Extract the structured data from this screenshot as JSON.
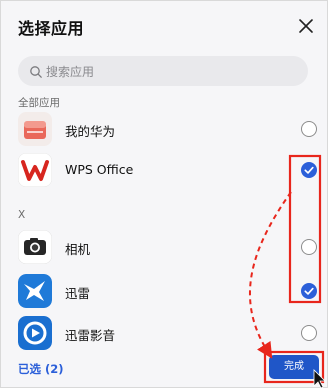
{
  "dialog": {
    "title": "选择应用"
  },
  "search": {
    "placeholder": "搜索应用"
  },
  "sections": {
    "all_apps_label": "全部应用",
    "x_label": "X"
  },
  "apps": [
    {
      "name": "我的华为",
      "icon": "myhuawei-icon",
      "selected": false
    },
    {
      "name": "WPS Office",
      "icon": "wps-office-icon",
      "selected": true
    },
    {
      "name": "相机",
      "icon": "camera-icon",
      "selected": false
    },
    {
      "name": "迅雷",
      "icon": "xunlei-icon",
      "selected": true
    },
    {
      "name": "迅雷影音",
      "icon": "xunlei-player-icon",
      "selected": false
    }
  ],
  "footer": {
    "selected_label": "已选 (2)",
    "done_label": "完成"
  },
  "colors": {
    "accent": "#2b5fd9",
    "annotation_red": "#e8261c",
    "wps_red": "#d7261f",
    "xunlei_blue": "#1f7ad8"
  }
}
